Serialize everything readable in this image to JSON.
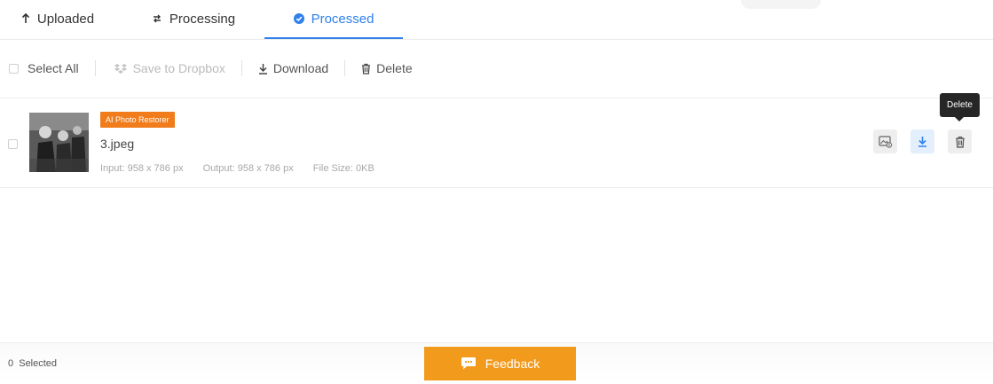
{
  "tabs": [
    {
      "label": "Uploaded",
      "icon": "arrow-up-icon"
    },
    {
      "label": "Processing",
      "icon": "sync-icon"
    },
    {
      "label": "Processed",
      "icon": "check-circle-icon",
      "active": true
    }
  ],
  "toolbar": {
    "select_all": "Select All",
    "save_dropbox": "Save to Dropbox",
    "download": "Download",
    "delete": "Delete"
  },
  "file": {
    "badge": "AI Photo Restorer",
    "name": "3.jpeg",
    "input": "Input: 958 x 786 px",
    "output": "Output: 958 x 786 px",
    "size": "File Size: 0KB"
  },
  "tooltip": "Delete",
  "footer": {
    "selected": "0  Selected",
    "feedback": "Feedback"
  },
  "colors": {
    "accent": "#2f80ed",
    "badge": "#f07c1b",
    "feedback": "#f29a1c"
  }
}
